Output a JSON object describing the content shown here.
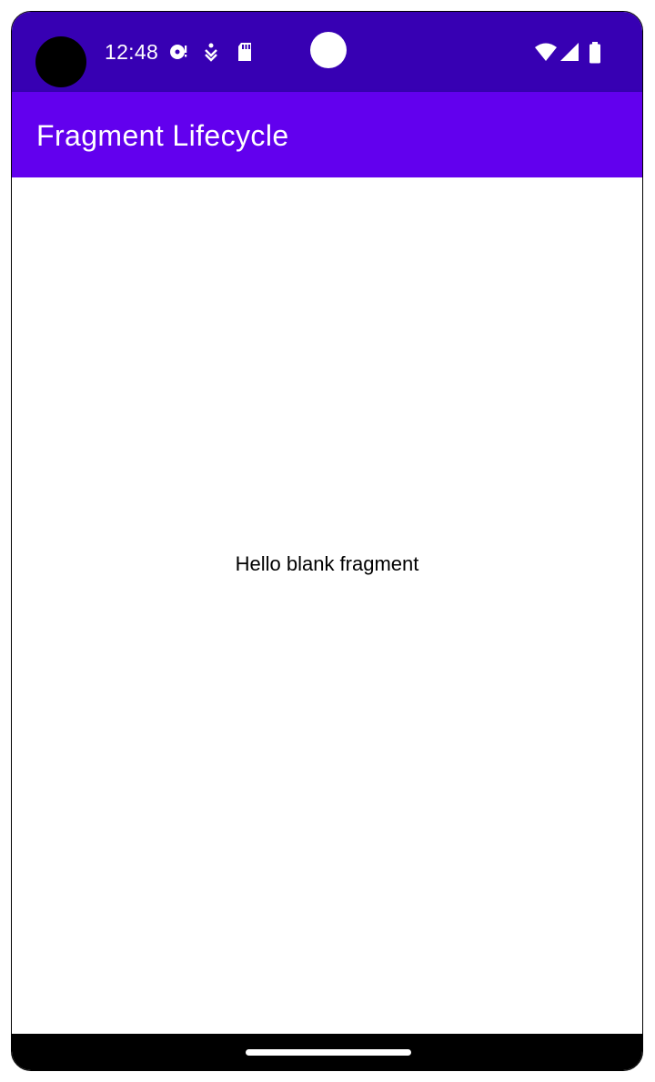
{
  "status_bar": {
    "time": "12:48",
    "notification_icons": [
      "disc-sync-icon",
      "download-notification-icon",
      "sd-card-icon"
    ],
    "system_icons": [
      "wifi-icon",
      "cellular-signal-icon",
      "battery-icon"
    ],
    "background_color": "#3700b3"
  },
  "app_bar": {
    "title": "Fragment Lifecycle",
    "background_color": "#6200ee"
  },
  "content": {
    "message": "Hello blank fragment"
  },
  "nav_bar": {
    "handle": "home-gesture-handle"
  }
}
